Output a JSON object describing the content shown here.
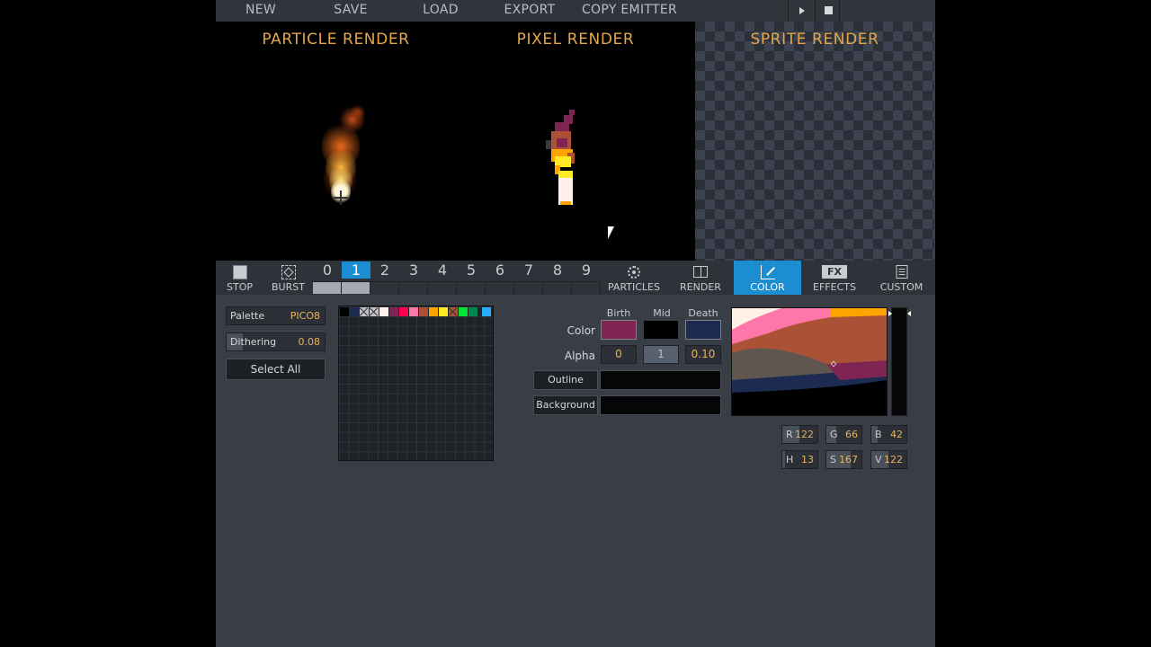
{
  "menu": {
    "new": "NEW",
    "save": "SAVE",
    "load": "LOAD",
    "export": "EXPORT",
    "copy_emitter": "COPY EMITTER"
  },
  "panels": {
    "particle": "PARTICLE RENDER",
    "pixel": "PIXEL RENDER",
    "sprite": "SPRITE RENDER"
  },
  "toolbar": {
    "stop": "STOP",
    "burst": "BURST",
    "emitters": [
      "0",
      "1",
      "2",
      "3",
      "4",
      "5",
      "6",
      "7",
      "8",
      "9"
    ],
    "active_emitter": 1,
    "particles": "PARTICLES",
    "render": "RENDER",
    "color": "COLOR",
    "effects": "EFFECTS",
    "fx_badge": "FX",
    "custom": "CUSTOM"
  },
  "properties": {
    "palette_label": "Palette",
    "palette_value": "PICO8",
    "dithering_label": "Dithering",
    "dithering_value": "0.08",
    "select_all": "Select All"
  },
  "palette_swatches": [
    "#000000",
    "#1d2b53",
    "#7e2553",
    "#c2c3c7",
    "#c2c3c7",
    "#fff1e8",
    "#7e2553",
    "#ff004d",
    "#ff77a8",
    "#ab5236",
    "#ffa300",
    "#ffec27",
    "#ab5236",
    "#00e436",
    "#008751",
    "#29adff"
  ],
  "color_section": {
    "birth": "Birth",
    "mid": "Mid",
    "death": "Death",
    "color_label": "Color",
    "alpha_label": "Alpha",
    "birth_color": "#7e2553",
    "mid_color": "#000000",
    "death_color": "#1d2b53",
    "alpha_birth": "0",
    "alpha_mid": "1",
    "alpha_death": "0.10",
    "outline": "Outline",
    "background": "Background"
  },
  "rgb": {
    "r_label": "R",
    "r": "122",
    "g_label": "G",
    "g": "66",
    "b_label": "B",
    "b": "42",
    "h_label": "H",
    "h": "13",
    "s_label": "S",
    "s": "167",
    "v_label": "V",
    "v": "122"
  },
  "accent": "#1a8ed0",
  "value_color": "#e6b35b"
}
